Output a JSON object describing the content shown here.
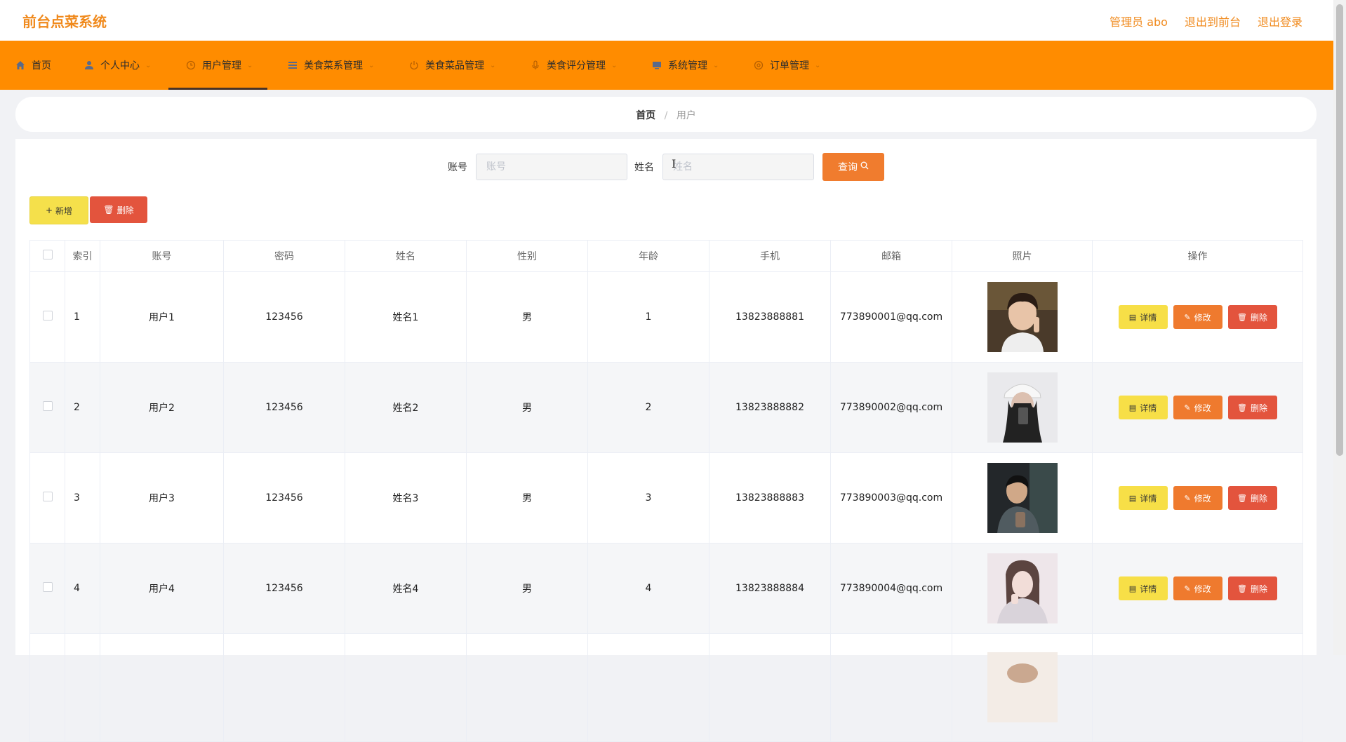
{
  "header": {
    "app_title": "前台点菜系统",
    "admin": "管理员 abo",
    "back_front": "退出到前台",
    "logout": "退出登录"
  },
  "nav": [
    {
      "label": "首页",
      "icon": "home-icon"
    },
    {
      "label": "个人中心",
      "icon": "person-icon"
    },
    {
      "label": "用户管理",
      "icon": "clock-icon",
      "active": true
    },
    {
      "label": "美食菜系管理",
      "icon": "list-icon"
    },
    {
      "label": "美食菜品管理",
      "icon": "power-icon"
    },
    {
      "label": "美食评分管理",
      "icon": "mic-icon"
    },
    {
      "label": "系统管理",
      "icon": "monitor-icon"
    },
    {
      "label": "订单管理",
      "icon": "gear-icon"
    }
  ],
  "breadcrumb": {
    "home": "首页",
    "sep": "/",
    "current": "用户"
  },
  "search": {
    "account_label": "账号",
    "account_placeholder": "账号",
    "name_label": "姓名",
    "name_placeholder": "姓名",
    "query_label": "查询"
  },
  "actions": {
    "add_label": "新增",
    "delete_label": "删除"
  },
  "table": {
    "headers": [
      "索引",
      "账号",
      "密码",
      "姓名",
      "性别",
      "年龄",
      "手机",
      "邮箱",
      "照片",
      "操作"
    ],
    "rows": [
      {
        "index": "1",
        "account": "用户1",
        "password": "123456",
        "name": "姓名1",
        "gender": "男",
        "age": "1",
        "phone": "13823888881",
        "email": "773890001@qq.com"
      },
      {
        "index": "2",
        "account": "用户2",
        "password": "123456",
        "name": "姓名2",
        "gender": "男",
        "age": "2",
        "phone": "13823888882",
        "email": "773890002@qq.com"
      },
      {
        "index": "3",
        "account": "用户3",
        "password": "123456",
        "name": "姓名3",
        "gender": "男",
        "age": "3",
        "phone": "13823888883",
        "email": "773890003@qq.com"
      },
      {
        "index": "4",
        "account": "用户4",
        "password": "123456",
        "name": "姓名4",
        "gender": "男",
        "age": "4",
        "phone": "13823888884",
        "email": "773890004@qq.com"
      }
    ],
    "row_buttons": {
      "detail": "详情",
      "edit": "修改",
      "delete": "删除"
    }
  },
  "colors": {
    "brand": "#f08a1d",
    "nav_bg": "#ff8c00",
    "danger": "#e3543d",
    "warning": "#f7df47",
    "edit": "#ef7a2e"
  }
}
